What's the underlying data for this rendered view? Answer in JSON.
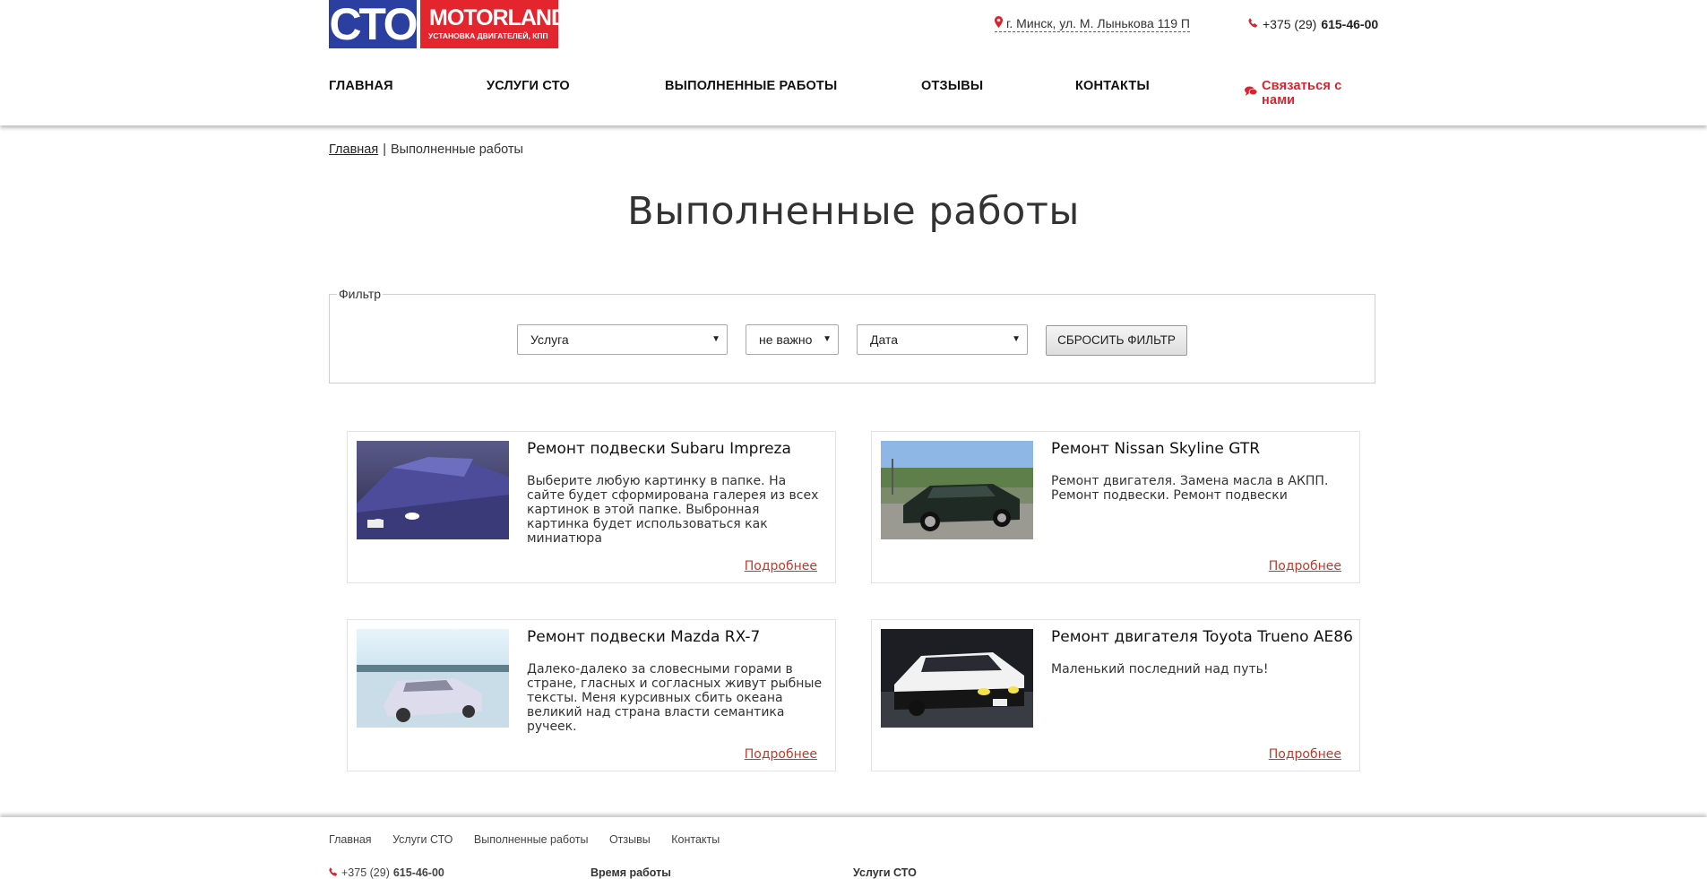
{
  "header": {
    "logo_left": "СТО",
    "logo_brand": "MOTORLAND",
    "logo_sub": "УСТАНОВКА ДВИГАТЕЛЕЙ, КПП",
    "address": "г. Минск, ул. М. Лынькова 119 П",
    "phone_prefix": "+375 (29)",
    "phone_number": "615-46-00"
  },
  "nav": {
    "items": [
      "ГЛАВНАЯ",
      "УСЛУГИ СТО",
      "ВЫПОЛНЕННЫЕ РАБОТЫ",
      "ОТЗЫВЫ",
      "КОНТАКТЫ"
    ],
    "contact": "Связаться с нами"
  },
  "breadcrumb": {
    "home": "Главная",
    "separator": "|",
    "current": "Выполненные работы"
  },
  "page_title": "Выполненные работы",
  "filter": {
    "legend": "Фильтр",
    "service": "Услуга",
    "any": "не важно",
    "date": "Дата",
    "reset": "СБРОСИТЬ ФИЛЬТР"
  },
  "works": [
    {
      "title": "Ремонт подвески Subaru Impreza",
      "text": "Выберите любую картинку в папке. На сайте будет сформирована галерея из всех картинок в этой папке. Выбронная картинка будет использоваться как миниатюра",
      "more": "Подробнее"
    },
    {
      "title": "Ремонт Nissan Skyline GTR",
      "text": "Ремонт двигателя. Замена масла в АКПП. Ремонт подвески. Ремонт подвески",
      "more": "Подробнее"
    },
    {
      "title": "Ремонт подвески Mazda RX-7",
      "text": "Далеко-далеко за словесными горами в стране, гласных и согласных живут рыбные тексты. Меня курсивных сбить океана великий над страна власти семантика ручеек.",
      "more": "Подробнее"
    },
    {
      "title": "Ремонт двигателя Toyota Trueno AE86",
      "text": "Маленький последний над путь!",
      "more": "Подробнее"
    }
  ],
  "footer": {
    "nav": [
      "Главная",
      "Услуги СТО",
      "Выполненные работы",
      "Отзывы",
      "Контакты"
    ],
    "phone_prefix": "+375 (29)",
    "phone_number": "615-46-00",
    "col2_title": "Время работы",
    "col3_title": "Услуги СТО"
  },
  "colors": {
    "brand_blue": "#2b3fa1",
    "brand_red": "#e3262d",
    "link_red": "#c0392b"
  }
}
